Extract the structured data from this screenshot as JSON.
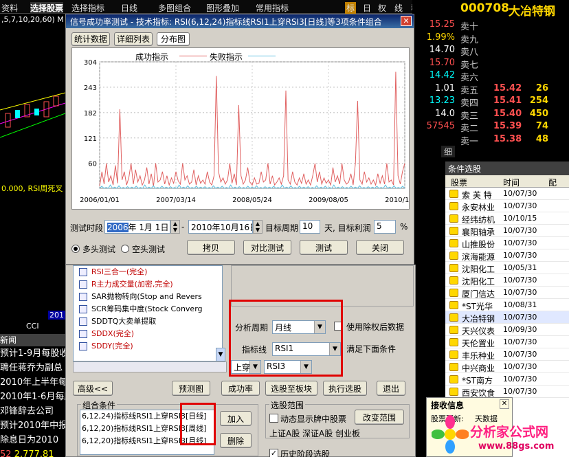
{
  "toolbar": {
    "items": [
      "资料",
      "选择股票",
      "选择指标",
      "日线",
      "多图组合",
      "图形叠加",
      "常用指标"
    ],
    "right_items": [
      "标",
      "日",
      "权",
      "线",
      "移"
    ]
  },
  "left_chart": {
    "params": ",5,7,10,20,60) M",
    "rsi_label": "0.000, RSI周死叉",
    "cci": "CCI",
    "year": "201"
  },
  "quote": {
    "code": "000708",
    "name": "大冶特钢",
    "left_values": [
      "15.25",
      "1.99%",
      "14.70",
      "15.70",
      "14.42",
      "1.01",
      "13.23",
      "14.0",
      "57545"
    ],
    "sell_labels": [
      "卖十",
      "卖九",
      "卖八",
      "卖七",
      "卖六",
      "卖五",
      "卖四",
      "卖三",
      "卖二",
      "卖一"
    ],
    "sell_prices": [
      "",
      "",
      "",
      "",
      "",
      "15.42",
      "15.41",
      "15.40",
      "15.39",
      "15.38"
    ],
    "sell_vols": [
      "",
      "",
      "",
      "",
      "",
      "26",
      "254",
      "450",
      "74",
      "48"
    ],
    "fine_label": "细"
  },
  "stock_panel": {
    "title": "条件选股",
    "headers": [
      "股票",
      "时间",
      "配"
    ],
    "rows": [
      {
        "name": "索 芙 特",
        "date": "10/07/30"
      },
      {
        "name": "永安林业",
        "date": "10/07/30"
      },
      {
        "name": "经纬纺机",
        "date": "10/10/15"
      },
      {
        "name": "襄阳轴承",
        "date": "10/07/30"
      },
      {
        "name": "山推股份",
        "date": "10/07/30"
      },
      {
        "name": "滨海能源",
        "date": "10/07/30"
      },
      {
        "name": "沈阳化工",
        "date": "10/05/31"
      },
      {
        "name": "沈阳化工",
        "date": "10/07/30"
      },
      {
        "name": "厦门信达",
        "date": "10/07/30"
      },
      {
        "name": "*ST光华",
        "date": "10/08/31"
      },
      {
        "name": "大冶特钢",
        "date": "10/07/30"
      },
      {
        "name": "天兴仪表",
        "date": "10/09/30"
      },
      {
        "name": "天伦置业",
        "date": "10/07/30"
      },
      {
        "name": "丰乐种业",
        "date": "10/07/30"
      },
      {
        "name": "中兴商业",
        "date": "10/07/30"
      },
      {
        "name": "*ST南方",
        "date": "10/07/30"
      },
      {
        "name": "西安饮食",
        "date": "10/07/30"
      }
    ]
  },
  "receive": {
    "title": "接收信息",
    "line1": "股票更新:",
    "line2": "天数据",
    "close": "✕"
  },
  "watermark": {
    "text": "分析家公式网",
    "url": "www.88gs.com"
  },
  "news": {
    "title": "新闻",
    "lines": [
      "预计1-9月每股收",
      "聘任蒋乔为副总",
      "2010年上半年每",
      "2010年1-6月每股",
      "邓锋辞去公司",
      "预计2010年中报",
      "除息日为2010",
      "2.777.81"
    ],
    "num": "52"
  },
  "dialog": {
    "title": "信号成功率测试 - 技术指标: RSI(6,12,24)指标线RSI1上穿RSI3[日线]等3项条件组合",
    "tabs": [
      "统计数据",
      "详细列表",
      "分布图"
    ],
    "legend_success": "成功指示",
    "legend_fail": "失败指示",
    "yticks": [
      "304",
      "243",
      "182",
      "121",
      "60"
    ],
    "xticks": [
      "2006/01/01",
      "2007/03/14",
      "2008/05/24",
      "2009/08/05",
      "2010/10/16"
    ],
    "period_label": "测试时段",
    "start": {
      "y": "2006",
      "rest": "年 1月 1日"
    },
    "dash": "-",
    "end": "2010年10月16日",
    "target_period_label": "目标周期",
    "target_period": "10",
    "target_rate_label": "天, 目标利润",
    "target_rate": "5",
    "pct": "%",
    "radio_long": "多头测试",
    "radio_short": "空头测试",
    "btn_copy": "拷贝",
    "btn_compare": "对比测试",
    "btn_test": "测试",
    "btn_close": "关闭"
  },
  "chart_data": {
    "type": "line",
    "ylim": [
      0,
      304
    ],
    "yticks": [
      304,
      243,
      182,
      121,
      60
    ],
    "x_start": "2006/01/01",
    "x_end": "2010/10/16",
    "xticks": [
      "2006/01/01",
      "2007/03/14",
      "2008/05/24",
      "2009/08/05",
      "2010/10/16"
    ],
    "series": [
      {
        "name": "成功指示",
        "color": "#e06060",
        "values": [
          5,
          40,
          10,
          60,
          15,
          30,
          8,
          55,
          12,
          190,
          20,
          40,
          8,
          25,
          60,
          10,
          45,
          15,
          30,
          8,
          20,
          50,
          10,
          35,
          5,
          60,
          15,
          20,
          40,
          10,
          30,
          8,
          25,
          12,
          40,
          18,
          10,
          60,
          20,
          30,
          10,
          15,
          45,
          8,
          30,
          12,
          20,
          10,
          40,
          15,
          8,
          30,
          270,
          40,
          15,
          25,
          10,
          20,
          60,
          12,
          35,
          8,
          200,
          30,
          10,
          20,
          50,
          15,
          8,
          25,
          10,
          12,
          40,
          15,
          20,
          60,
          10,
          30,
          8,
          15,
          25,
          10,
          30,
          235,
          20,
          10,
          40,
          15,
          8,
          25,
          12,
          35,
          10,
          20,
          8,
          30,
          60,
          15,
          40,
          10,
          25,
          12,
          20,
          8,
          50,
          15,
          30,
          10,
          60,
          20,
          10,
          15,
          35,
          8,
          60,
          210,
          20,
          10,
          40,
          15,
          25,
          10,
          20,
          8,
          35,
          12,
          30,
          10,
          60,
          15,
          20,
          8,
          280,
          30,
          10,
          40,
          60
        ]
      },
      {
        "name": "失败指示",
        "color": "#60c0e0",
        "values": [
          0,
          5,
          0,
          2,
          0,
          8,
          0,
          3,
          0,
          6,
          0,
          2,
          0,
          4,
          0,
          3,
          0,
          5,
          0,
          2,
          0,
          8,
          0,
          3,
          0,
          6,
          0,
          2,
          0,
          5,
          0,
          3,
          0,
          4,
          0,
          2,
          0,
          8,
          0,
          3,
          0,
          6,
          0,
          2,
          0,
          5,
          0,
          3,
          0,
          4,
          0,
          2,
          0,
          6,
          0,
          3,
          0,
          5,
          0,
          2,
          0,
          8,
          0,
          3,
          0,
          4,
          0,
          2,
          0,
          5,
          0,
          3,
          0,
          6,
          0,
          2,
          0,
          4,
          0,
          3,
          0,
          5,
          0,
          2,
          0,
          8,
          0,
          3,
          0,
          6,
          0,
          2,
          0,
          5,
          0,
          3,
          0,
          4,
          0,
          2,
          0,
          6,
          0,
          3,
          0,
          5,
          0,
          2,
          0,
          8,
          0,
          3,
          0,
          4,
          0,
          2,
          0,
          5,
          0,
          3,
          0,
          6,
          0,
          2,
          0,
          4,
          0,
          3,
          0,
          5,
          0,
          2,
          0,
          8,
          0,
          3,
          0,
          6,
          0,
          2,
          0,
          5,
          0
        ]
      }
    ]
  },
  "lower": {
    "list_items": [
      {
        "text": "RSI三合一(完全)",
        "color": "#c00000"
      },
      {
        "text": "R主力成交量(加密,完全)",
        "color": "#c00000"
      },
      {
        "text": "SAR抛物转向(Stop and Revers",
        "color": "#000"
      },
      {
        "text": "SCR筹码集中度(Stock Converg",
        "color": "#000"
      },
      {
        "text": "SDDTQ大卖单提取",
        "color": "#000"
      },
      {
        "text": "SDDX(完全)",
        "color": "#c00000"
      },
      {
        "text": "SDDY(完全)",
        "color": "#c00000"
      }
    ],
    "analysis_period_label": "分析周期",
    "analysis_period": "月线",
    "use_adj_label": "使用除权后数据",
    "indicator_label": "指标线",
    "indicator": "RSI1",
    "satisfy_label": "满足下面条件",
    "cross": "上穿",
    "cross_target": "RSI3",
    "btn_advanced": "高级<<",
    "btn_preview": "预测图",
    "btn_success": "成功率",
    "btn_to_block": "选股至板块",
    "btn_execute": "执行选股",
    "btn_exit": "退出",
    "combo_title": "组合条件",
    "combo_lines": [
      "6,12,24)指标线RSI1上穿RSI3[日线]",
      "6,12,20)指标线RSI1上穿RSI3[周线]",
      "6,12,20)指标线RSI1上穿RSI3[月线]"
    ],
    "btn_add": "加入",
    "btn_delete": "删除",
    "range_title": "选股范围",
    "dynamic_label": "动态显示牌中股票",
    "btn_change_range": "改变范围",
    "range_text": "上证A股 深证A股 创业板",
    "history_label": "历史阶段选股"
  }
}
